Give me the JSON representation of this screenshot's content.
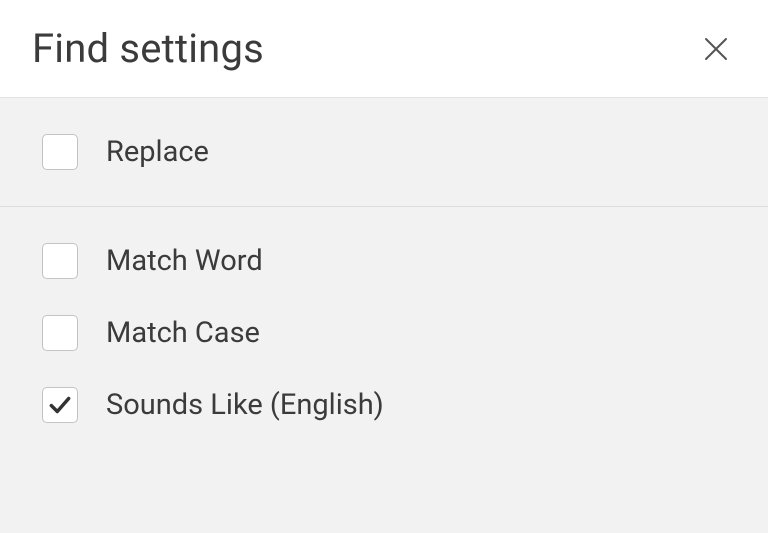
{
  "header": {
    "title": "Find settings"
  },
  "groups": [
    {
      "options": [
        {
          "id": "replace",
          "label": "Replace",
          "checked": false
        }
      ]
    },
    {
      "options": [
        {
          "id": "match-word",
          "label": "Match Word",
          "checked": false
        },
        {
          "id": "match-case",
          "label": "Match Case",
          "checked": false
        },
        {
          "id": "sounds-like",
          "label": "Sounds Like (English)",
          "checked": true
        }
      ]
    }
  ]
}
